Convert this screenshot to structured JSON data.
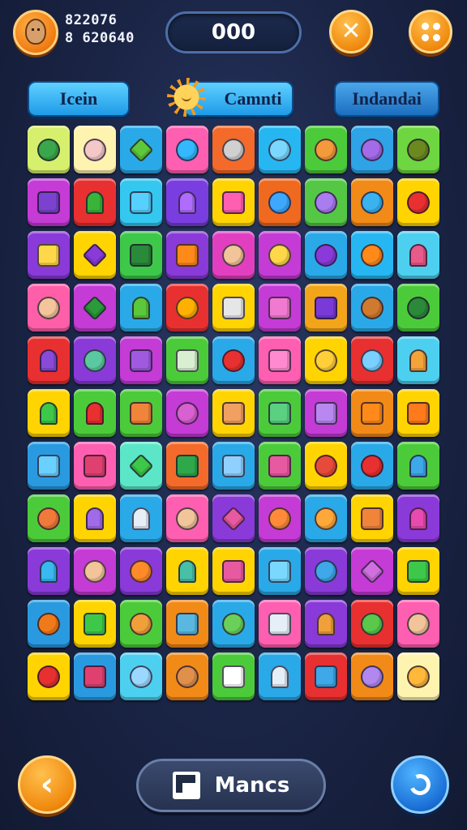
{
  "header": {
    "score_line_1": "822076",
    "score_line_2": "8 620640",
    "counter": "000",
    "close_label": "close",
    "menu_label": "menu"
  },
  "tabs": [
    {
      "label": "Icein"
    },
    {
      "label": "Camnti"
    },
    {
      "label": "Indandai"
    }
  ],
  "board": {
    "columns": 9,
    "rows": 11,
    "tiles": [
      [
        [
          "#d6f06e",
          "#3aa84a",
          "c"
        ],
        [
          "#fff3b0",
          "#f4c8c8",
          "c"
        ],
        [
          "#2aa9e8",
          "#5cc83a",
          "dm"
        ],
        [
          "#ff5fb0",
          "#34b8ff",
          "c"
        ],
        [
          "#f46a2a",
          "#d0d0d0",
          "c"
        ],
        [
          "#26b7f2",
          "#7ad8ff",
          "c"
        ],
        [
          "#4ccb3a",
          "#f39a3c",
          "c"
        ],
        [
          "#2ea3e6",
          "#a46be8",
          "c"
        ],
        [
          "#6ed640",
          "#6a8a20",
          "c"
        ]
      ],
      [
        [
          "#c53bd6",
          "#7b42d0",
          "sq"
        ],
        [
          "#e83030",
          "#39b43a",
          "pl"
        ],
        [
          "#34c8f0",
          "#55d0ff",
          "sq"
        ],
        [
          "#7a3ee0",
          "#b06cff",
          "pl"
        ],
        [
          "#ffd400",
          "#ff5fb0",
          "sq"
        ],
        [
          "#ef6a1e",
          "#3ea8ff",
          "c"
        ],
        [
          "#54c844",
          "#a97cf0",
          "c"
        ],
        [
          "#f28a18",
          "#3ab2f0",
          "c"
        ],
        [
          "#ffd400",
          "#e83030",
          "c"
        ]
      ],
      [
        [
          "#8a3ad8",
          "#ffd84a",
          "sq"
        ],
        [
          "#ffd400",
          "#8a3ad8",
          "dm"
        ],
        [
          "#3ec84a",
          "#2a8a3a",
          "sq"
        ],
        [
          "#8a3ad8",
          "#ff8a1a",
          "sq"
        ],
        [
          "#e23fc0",
          "#f2c49a",
          "c"
        ],
        [
          "#c53bd6",
          "#ffd84a",
          "c"
        ],
        [
          "#2aa9e8",
          "#8a3ad8",
          "c"
        ],
        [
          "#26b7f2",
          "#ff8a1a",
          "c"
        ],
        [
          "#4dd0f0",
          "#e85a8a",
          "pl"
        ]
      ],
      [
        [
          "#ff5fa8",
          "#f4c49a",
          "c"
        ],
        [
          "#c53bd6",
          "#2a9a3a",
          "dm"
        ],
        [
          "#2aa9e8",
          "#5ac83a",
          "pl"
        ],
        [
          "#e83030",
          "#ffb000",
          "c"
        ],
        [
          "#ffd400",
          "#e6e6e6",
          "sq"
        ],
        [
          "#c53bd6",
          "#f07ad0",
          "sq"
        ],
        [
          "#f2a41a",
          "#7a3ad8",
          "sq"
        ],
        [
          "#2aa9e8",
          "#d07a30",
          "c"
        ],
        [
          "#4ccb3a",
          "#2a8a3a",
          "c"
        ]
      ],
      [
        [
          "#e83030",
          "#8a4ad8",
          "pl"
        ],
        [
          "#8a3ad8",
          "#5ac8a0",
          "c"
        ],
        [
          "#c53bd6",
          "#a05ae0",
          "sq"
        ],
        [
          "#4ccb3a",
          "#d8f0d0",
          "sq"
        ],
        [
          "#2aa9e8",
          "#e83030",
          "c"
        ],
        [
          "#ff5fb0",
          "#ff8ad0",
          "sq"
        ],
        [
          "#ffd400",
          "#ffcf3a",
          "c"
        ],
        [
          "#e83030",
          "#7ad0ff",
          "c"
        ],
        [
          "#4dd0f0",
          "#f2a43a",
          "pl"
        ]
      ],
      [
        [
          "#ffd400",
          "#3ec84a",
          "pl"
        ],
        [
          "#4ccb3a",
          "#e83030",
          "pl"
        ],
        [
          "#4ccb3a",
          "#f0843a",
          "sq"
        ],
        [
          "#c53bd6",
          "#d860d0",
          "c"
        ],
        [
          "#ffd400",
          "#f0a060",
          "sq"
        ],
        [
          "#4ccb3a",
          "#5ad080",
          "sq"
        ],
        [
          "#c53bd6",
          "#b888f0",
          "sq"
        ],
        [
          "#f28a18",
          "#ff8a1a",
          "sq"
        ],
        [
          "#ffd400",
          "#ff7a1a",
          "sq"
        ]
      ],
      [
        [
          "#2a9ae0",
          "#6ad0ff",
          "sq"
        ],
        [
          "#ff5fb0",
          "#e04070",
          "sq"
        ],
        [
          "#5ce6c8",
          "#3ec84a",
          "dm"
        ],
        [
          "#f46a2a",
          "#2ea84a",
          "sq"
        ],
        [
          "#2aa9e8",
          "#8fd0ff",
          "sq"
        ],
        [
          "#4ccb3a",
          "#e85aa0",
          "sq"
        ],
        [
          "#ffd400",
          "#e84a3a",
          "c"
        ],
        [
          "#2aa9e8",
          "#e83030",
          "c"
        ],
        [
          "#4ccb3a",
          "#3ea8e8",
          "pl"
        ]
      ],
      [
        [
          "#4ccb3a",
          "#f07a3a",
          "c"
        ],
        [
          "#ffd400",
          "#a06ae8",
          "pl"
        ],
        [
          "#2aa9e8",
          "#e6eef8",
          "pl"
        ],
        [
          "#ff5fb0",
          "#f2c49a",
          "c"
        ],
        [
          "#8a3ad8",
          "#e85aa0",
          "dm"
        ],
        [
          "#c53bd6",
          "#ff8a3a",
          "c"
        ],
        [
          "#2aa9e8",
          "#ffa83a",
          "c"
        ],
        [
          "#ffd400",
          "#f0843a",
          "sq"
        ],
        [
          "#8a3ad8",
          "#e84ab0",
          "pl"
        ]
      ],
      [
        [
          "#8a3ad8",
          "#3ab8f0",
          "pl"
        ],
        [
          "#c53bd6",
          "#f2c49a",
          "c"
        ],
        [
          "#8a3ad8",
          "#ff8a2a",
          "c"
        ],
        [
          "#ffd400",
          "#48c0a8",
          "pl"
        ],
        [
          "#ffd400",
          "#e85aa0",
          "sq"
        ],
        [
          "#2aa9e8",
          "#7ad8ff",
          "sq"
        ],
        [
          "#8a3ad8",
          "#3ea8e8",
          "c"
        ],
        [
          "#c53bd6",
          "#d070e0",
          "dm"
        ],
        [
          "#ffd400",
          "#3ec84a",
          "sq"
        ]
      ],
      [
        [
          "#2a9ae0",
          "#f07a1a",
          "c"
        ],
        [
          "#ffd400",
          "#3ec84a",
          "sq"
        ],
        [
          "#4ccb3a",
          "#f0a03a",
          "c"
        ],
        [
          "#f28a18",
          "#5ab8e0",
          "sq"
        ],
        [
          "#2aa9e8",
          "#6ad05a",
          "c"
        ],
        [
          "#ff5fb0",
          "#e6eef8",
          "sq"
        ],
        [
          "#8a3ad8",
          "#f0a03a",
          "pl"
        ],
        [
          "#e83030",
          "#5ac84a",
          "c"
        ],
        [
          "#ff5fb0",
          "#f2c49a",
          "c"
        ]
      ],
      [
        [
          "#ffd400",
          "#e83030",
          "c"
        ],
        [
          "#2a9ae0",
          "#e04070",
          "sq"
        ],
        [
          "#4dd0f0",
          "#9ad8ff",
          "c"
        ],
        [
          "#f28a18",
          "#e0904a",
          "c"
        ],
        [
          "#4ccb3a",
          "#ffffff",
          "sq"
        ],
        [
          "#2aa9e8",
          "#e6eef8",
          "pl"
        ],
        [
          "#e83030",
          "#3ea8e8",
          "sq"
        ],
        [
          "#f28a18",
          "#b088f0",
          "c"
        ],
        [
          "#fff3b0",
          "#ffb83a",
          "c"
        ]
      ]
    ]
  },
  "footer": {
    "back_label": "‹",
    "matches_label": "Mancs",
    "refresh_label": "refresh"
  }
}
